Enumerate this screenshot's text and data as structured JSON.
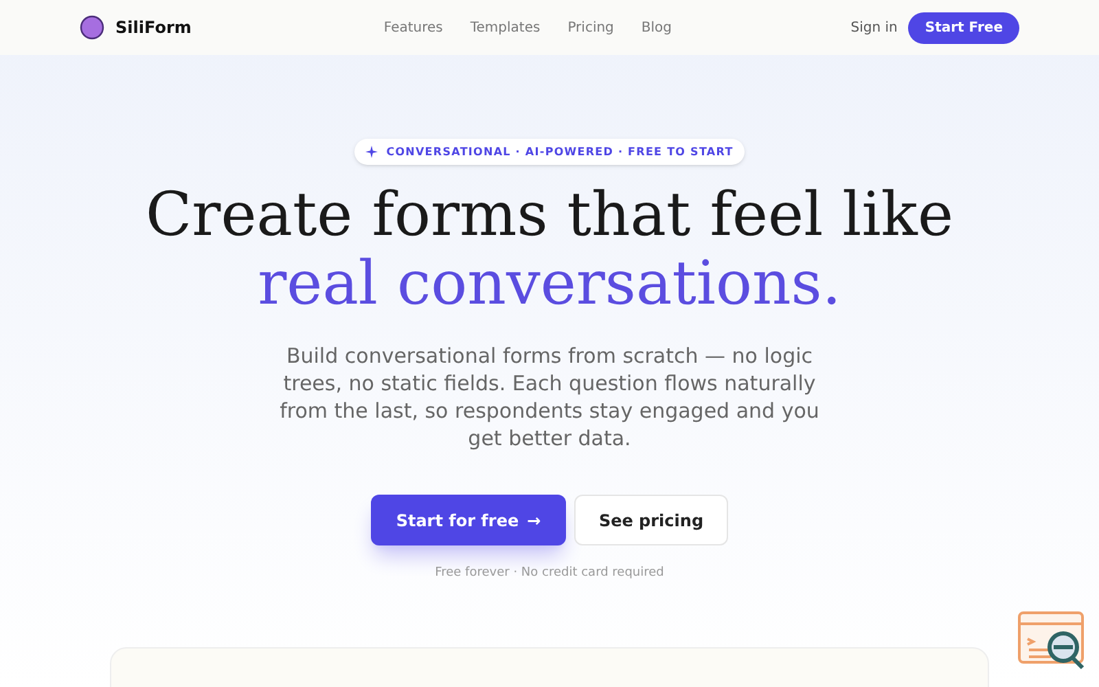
{
  "nav": {
    "brand": "SiliForm",
    "links": [
      "Features",
      "Templates",
      "Pricing",
      "Blog"
    ],
    "sign_in": "Sign in",
    "cta": "Start Free"
  },
  "hero": {
    "badge": "CONVERSATIONAL · AI-POWERED · FREE TO START",
    "title_line1": "Create forms that feel like",
    "title_line2": "real conversations.",
    "description": "Build conversational forms from scratch — no logic trees, no static fields. Each question flows naturally from the last, so respondents stay engaged and you get better data.",
    "primary_button": "Start for free",
    "primary_arrow": "→",
    "secondary_button": "See pricing",
    "note": "Free forever · No credit card required"
  }
}
